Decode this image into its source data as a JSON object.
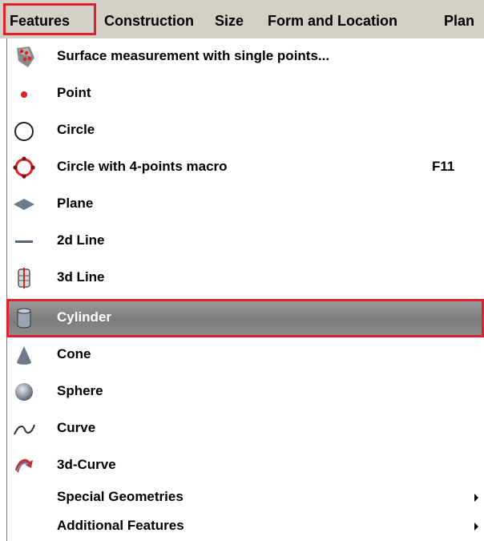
{
  "menubar": {
    "items": [
      {
        "label": "Features",
        "active": true
      },
      {
        "label": "Construction"
      },
      {
        "label": "Size"
      },
      {
        "label": "Form and Location"
      },
      {
        "label": "Plan"
      }
    ]
  },
  "menu": {
    "items": [
      {
        "label": "Surface measurement with single points...",
        "icon": "surface-points-icon"
      },
      {
        "label": "Point",
        "icon": "point-icon"
      },
      {
        "label": "Circle",
        "icon": "circle-icon"
      },
      {
        "label": "Circle with 4-points macro",
        "icon": "circle-4points-icon",
        "shortcut": "F11"
      },
      {
        "label": "Plane",
        "icon": "plane-icon"
      },
      {
        "label": "2d Line",
        "icon": "2d-line-icon"
      },
      {
        "label": "3d Line",
        "icon": "3d-line-icon"
      },
      {
        "label": "Cylinder",
        "icon": "cylinder-icon",
        "selected": true
      },
      {
        "label": "Cone",
        "icon": "cone-icon"
      },
      {
        "label": "Sphere",
        "icon": "sphere-icon"
      },
      {
        "label": "Curve",
        "icon": "curve-icon"
      },
      {
        "label": "3d-Curve",
        "icon": "3d-curve-icon"
      },
      {
        "label": "Special Geometries",
        "submenu": true
      },
      {
        "label": "Additional Features",
        "submenu": true
      }
    ]
  },
  "colors": {
    "menubar_bg": "#d4d0c8",
    "highlight_border": "#e0202a",
    "selected_bg": "#8a8a8a",
    "icon_red": "#e02020"
  }
}
